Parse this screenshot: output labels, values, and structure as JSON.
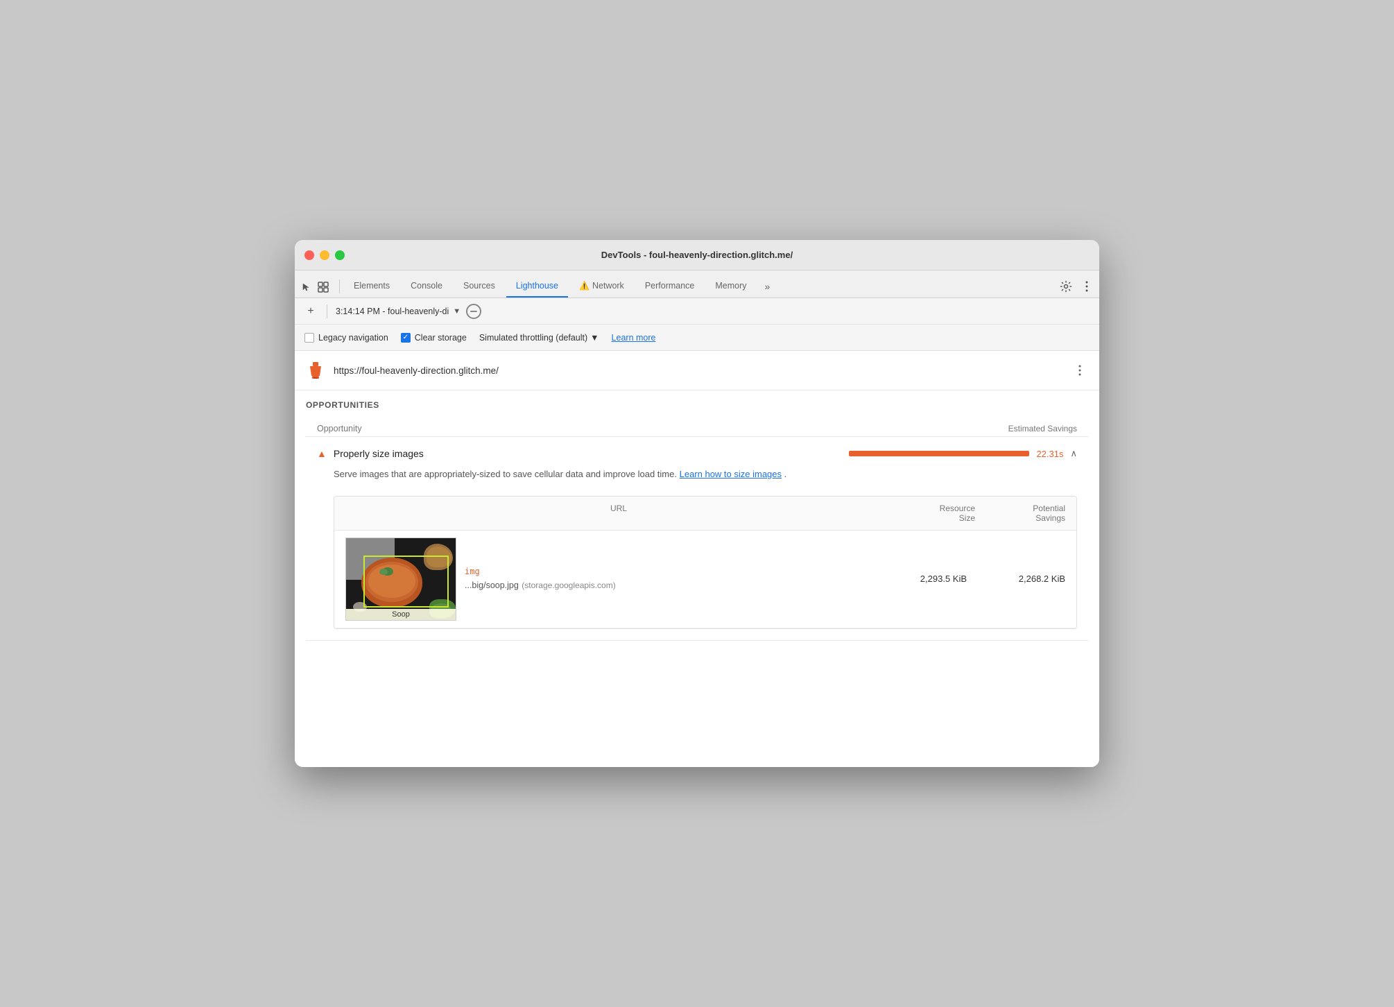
{
  "window": {
    "title": "DevTools - foul-heavenly-direction.glitch.me/"
  },
  "tabs": {
    "items": [
      {
        "label": "Elements",
        "active": false
      },
      {
        "label": "Console",
        "active": false
      },
      {
        "label": "Sources",
        "active": false
      },
      {
        "label": "Lighthouse",
        "active": true
      },
      {
        "label": "Network",
        "active": false,
        "warning": true
      },
      {
        "label": "Performance",
        "active": false
      },
      {
        "label": "Memory",
        "active": false
      }
    ],
    "more_label": "»"
  },
  "toolbar": {
    "add_label": "+",
    "session": "3:14:14 PM - foul-heavenly-di"
  },
  "options": {
    "legacy_navigation": {
      "label": "Legacy navigation",
      "checked": false
    },
    "clear_storage": {
      "label": "Clear storage",
      "checked": true
    },
    "throttling": {
      "label": "Simulated throttling (default)"
    },
    "learn_more": "Learn more"
  },
  "url_bar": {
    "url": "https://foul-heavenly-direction.glitch.me/",
    "lighthouse_icon": "🏠"
  },
  "opportunities": {
    "section_title": "OPPORTUNITIES",
    "col_opportunity": "Opportunity",
    "col_estimated_savings": "Estimated Savings",
    "items": [
      {
        "title": "Properly size images",
        "savings": "22.31s",
        "description": "Serve images that are appropriately-sized to save cellular data and improve load time.",
        "learn_link_text": "Learn how to size images",
        "table": {
          "col_url": "URL",
          "col_resource_size_line1": "Resource",
          "col_resource_size_line2": "Size",
          "col_potential_line1": "Potential",
          "col_potential_line2": "Savings",
          "rows": [
            {
              "tag": "img",
              "filename": "...big/soop.jpg",
              "domain": "(storage.googleapis.com)",
              "resource_size": "2,293.5 KiB",
              "potential_savings": "2,268.2 KiB",
              "image_label": "Soop"
            }
          ]
        }
      }
    ]
  }
}
